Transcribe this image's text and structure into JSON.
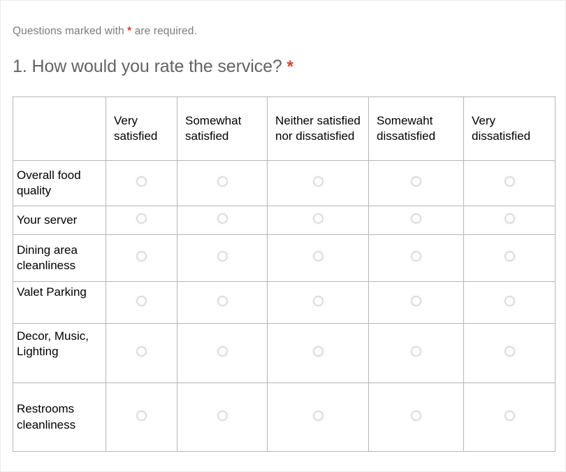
{
  "page": {
    "required_note_prefix": "Questions marked with ",
    "required_note_star": "*",
    "required_note_suffix": " are required.",
    "question_number_text": "1. How would you rate the service? ",
    "question_star": "*",
    "accent_red": "#e03e2d",
    "text_gray": "#636363",
    "note_gray": "#7b7b7b",
    "border_gray": "#b6b6b6",
    "radio_gray": "#dcdcdc"
  },
  "matrix": {
    "corner_label": "",
    "columns": [
      "Very satisfied",
      "Somewhat satisfied",
      "Neither satisfied nor dissatisfied",
      "Somewaht dissatisfied",
      "Very dissatisfied"
    ],
    "rows": [
      "Overall food quality",
      "Your server",
      "Dining area cleanliness",
      "Valet Parking",
      "Decor, Music, Lighting",
      "Restrooms cleanliness"
    ],
    "selected": [
      null,
      null,
      null,
      null,
      null,
      null
    ],
    "radio_icon": "radio-unchecked-icon"
  }
}
